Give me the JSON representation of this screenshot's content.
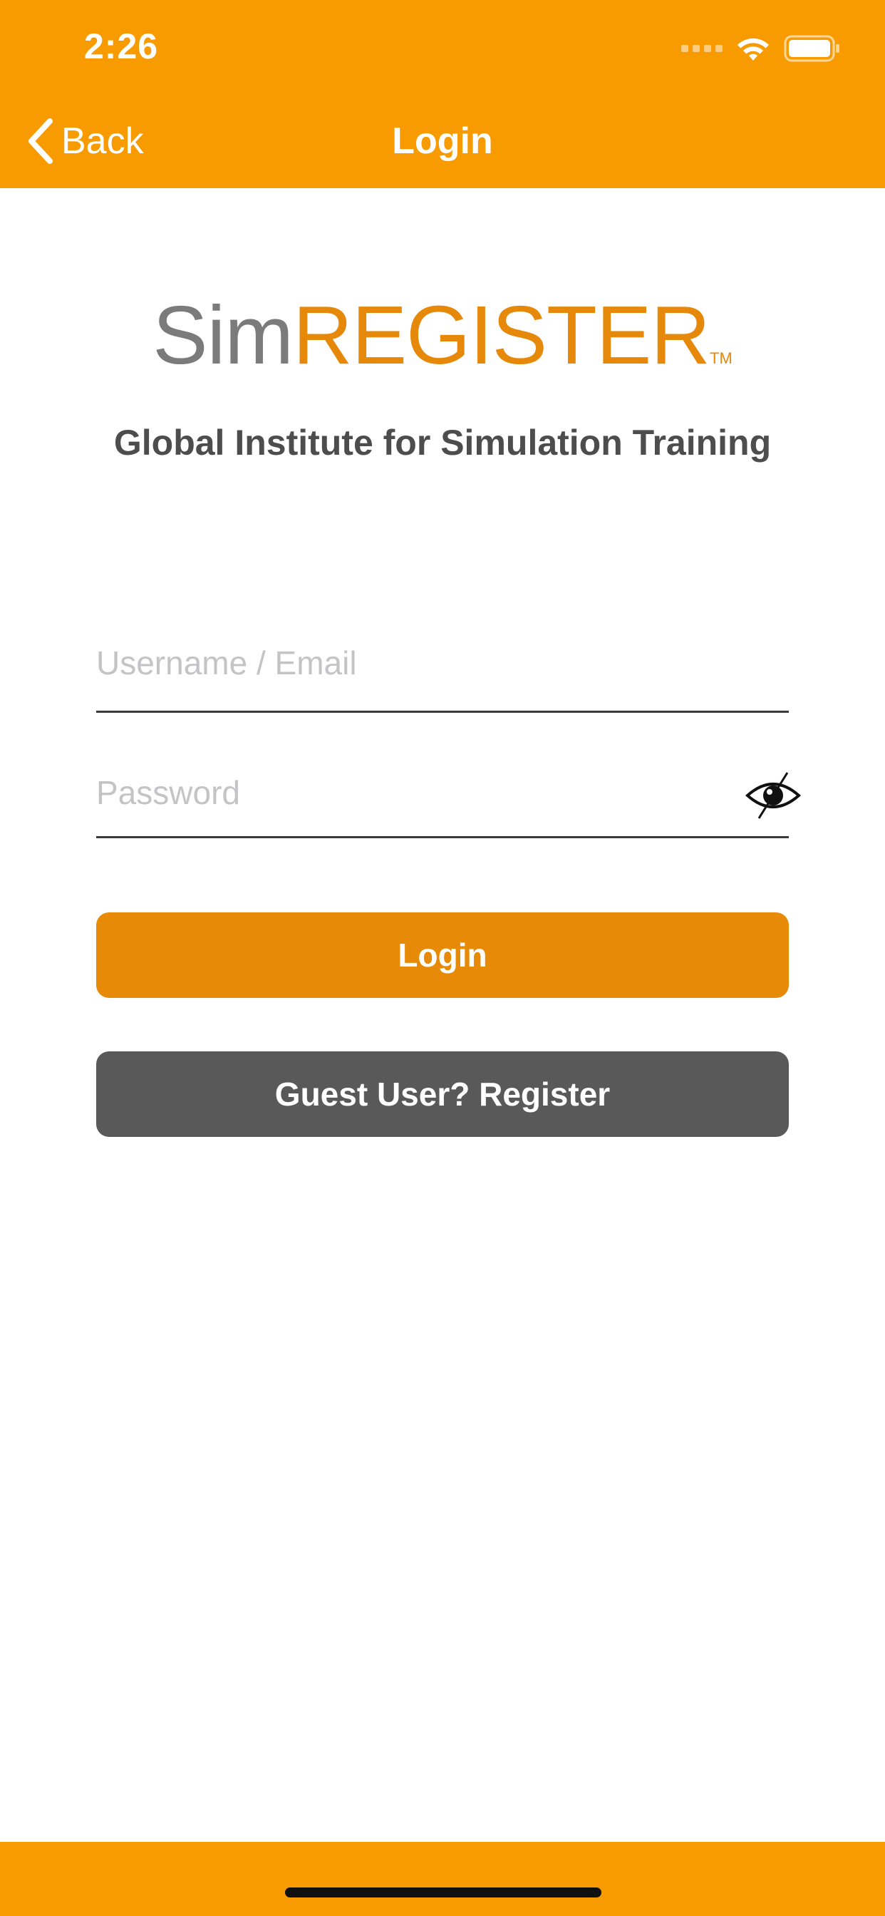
{
  "status_bar": {
    "time": "2:26"
  },
  "nav": {
    "back_label": "Back",
    "title": "Login"
  },
  "logo": {
    "part1": "Sim",
    "part2": "REGISTER",
    "tm": "TM"
  },
  "tagline": "Global Institute for Simulation Training",
  "form": {
    "username_placeholder": "Username / Email",
    "username_value": "",
    "password_placeholder": "Password",
    "password_value": ""
  },
  "buttons": {
    "login": "Login",
    "register": "Guest User? Register"
  },
  "icons": {
    "back": "chevron-left-icon",
    "wifi": "wifi-icon",
    "battery": "battery-icon",
    "password_toggle": "eye-slash-icon"
  },
  "colors": {
    "accent": "#f89b00",
    "button_primary": "#e68a07",
    "button_secondary": "#595959",
    "logo_gray": "#7b7b7b",
    "logo_orange": "#e6880a"
  }
}
